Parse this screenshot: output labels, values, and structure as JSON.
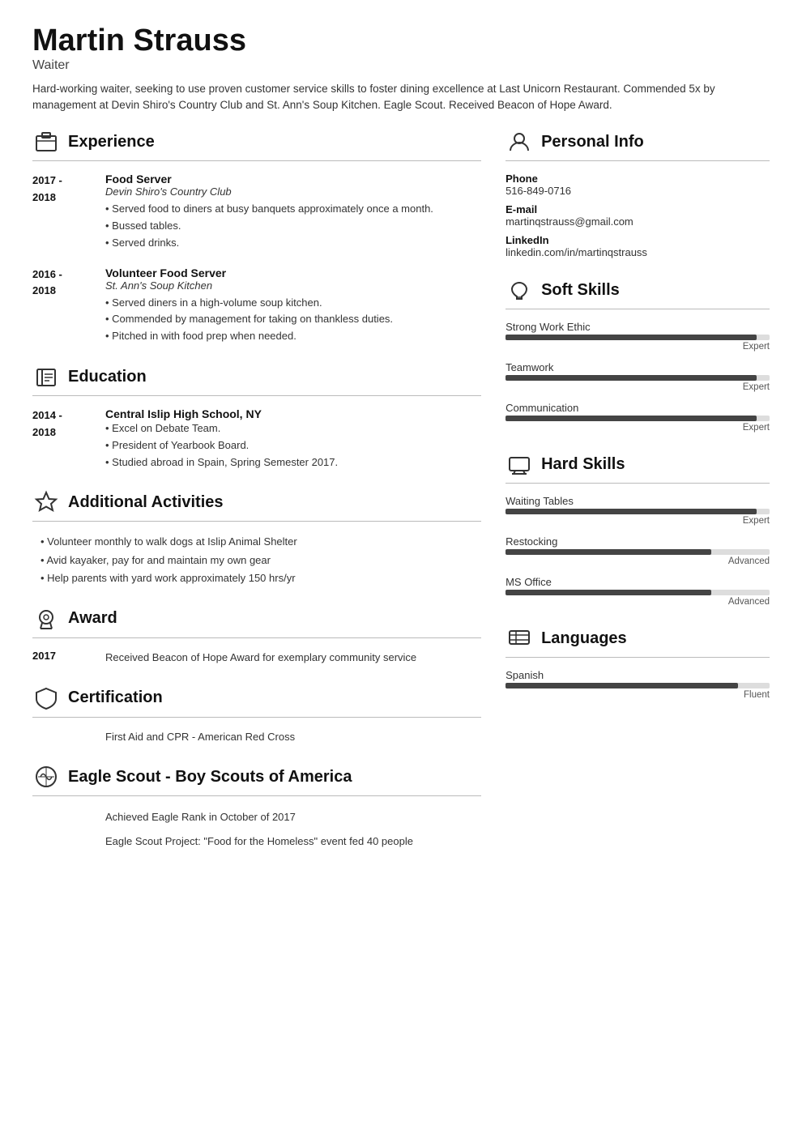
{
  "header": {
    "name": "Martin Strauss",
    "title": "Waiter",
    "summary": "Hard-working waiter, seeking to use proven customer service skills to foster dining excellence at Last Unicorn Restaurant. Commended 5x by management at Devin Shiro's Country Club and St. Ann's Soup Kitchen. Eagle Scout. Received Beacon of Hope Award."
  },
  "experience": {
    "section_title": "Experience",
    "entries": [
      {
        "date": "2017 -\n2018",
        "job_title": "Food Server",
        "org": "Devin Shiro's Country Club",
        "bullets": [
          "Served food to diners at busy banquets approximately once a month.",
          "Bussed tables.",
          "Served drinks."
        ]
      },
      {
        "date": "2016 -\n2018",
        "job_title": "Volunteer Food Server",
        "org": "St. Ann's Soup Kitchen",
        "bullets": [
          "Served diners in a high-volume soup kitchen.",
          "Commended by management for taking on thankless duties.",
          "Pitched in with food prep when needed."
        ]
      }
    ]
  },
  "education": {
    "section_title": "Education",
    "entries": [
      {
        "date": "2014 -\n2018",
        "school": "Central Islip High School, NY",
        "bullets": [
          "Excel on Debate Team.",
          "President of Yearbook Board.",
          "Studied abroad in Spain, Spring Semester 2017."
        ]
      }
    ]
  },
  "additional_activities": {
    "section_title": "Additional Activities",
    "items": [
      "Volunteer monthly to walk dogs at Islip Animal Shelter",
      "Avid kayaker, pay for and maintain my own gear",
      "Help parents with yard work approximately 150 hrs/yr"
    ]
  },
  "award": {
    "section_title": "Award",
    "entries": [
      {
        "year": "2017",
        "text": "Received Beacon of Hope Award for exemplary community service"
      }
    ]
  },
  "certification": {
    "section_title": "Certification",
    "text": "First Aid and CPR - American Red Cross"
  },
  "eagle_scout": {
    "section_title": "Eagle Scout - Boy Scouts of America",
    "lines": [
      "Achieved Eagle Rank in October of 2017",
      "Eagle Scout Project: \"Food for the Homeless\" event fed 40 people"
    ]
  },
  "personal_info": {
    "section_title": "Personal Info",
    "phone_label": "Phone",
    "phone": "516-849-0716",
    "email_label": "E-mail",
    "email": "martinqstrauss@gmail.com",
    "linkedin_label": "LinkedIn",
    "linkedin": "linkedin.com/in/martinqstrauss"
  },
  "soft_skills": {
    "section_title": "Soft Skills",
    "skills": [
      {
        "name": "Strong Work Ethic",
        "percent": 95,
        "label": "Expert"
      },
      {
        "name": "Teamwork",
        "percent": 95,
        "label": "Expert"
      },
      {
        "name": "Communication",
        "percent": 95,
        "label": "Expert"
      }
    ]
  },
  "hard_skills": {
    "section_title": "Hard Skills",
    "skills": [
      {
        "name": "Waiting Tables",
        "percent": 95,
        "label": "Expert"
      },
      {
        "name": "Restocking",
        "percent": 78,
        "label": "Advanced"
      },
      {
        "name": "MS Office",
        "percent": 78,
        "label": "Advanced"
      }
    ]
  },
  "languages": {
    "section_title": "Languages",
    "skills": [
      {
        "name": "Spanish",
        "percent": 88,
        "label": "Fluent"
      }
    ]
  }
}
